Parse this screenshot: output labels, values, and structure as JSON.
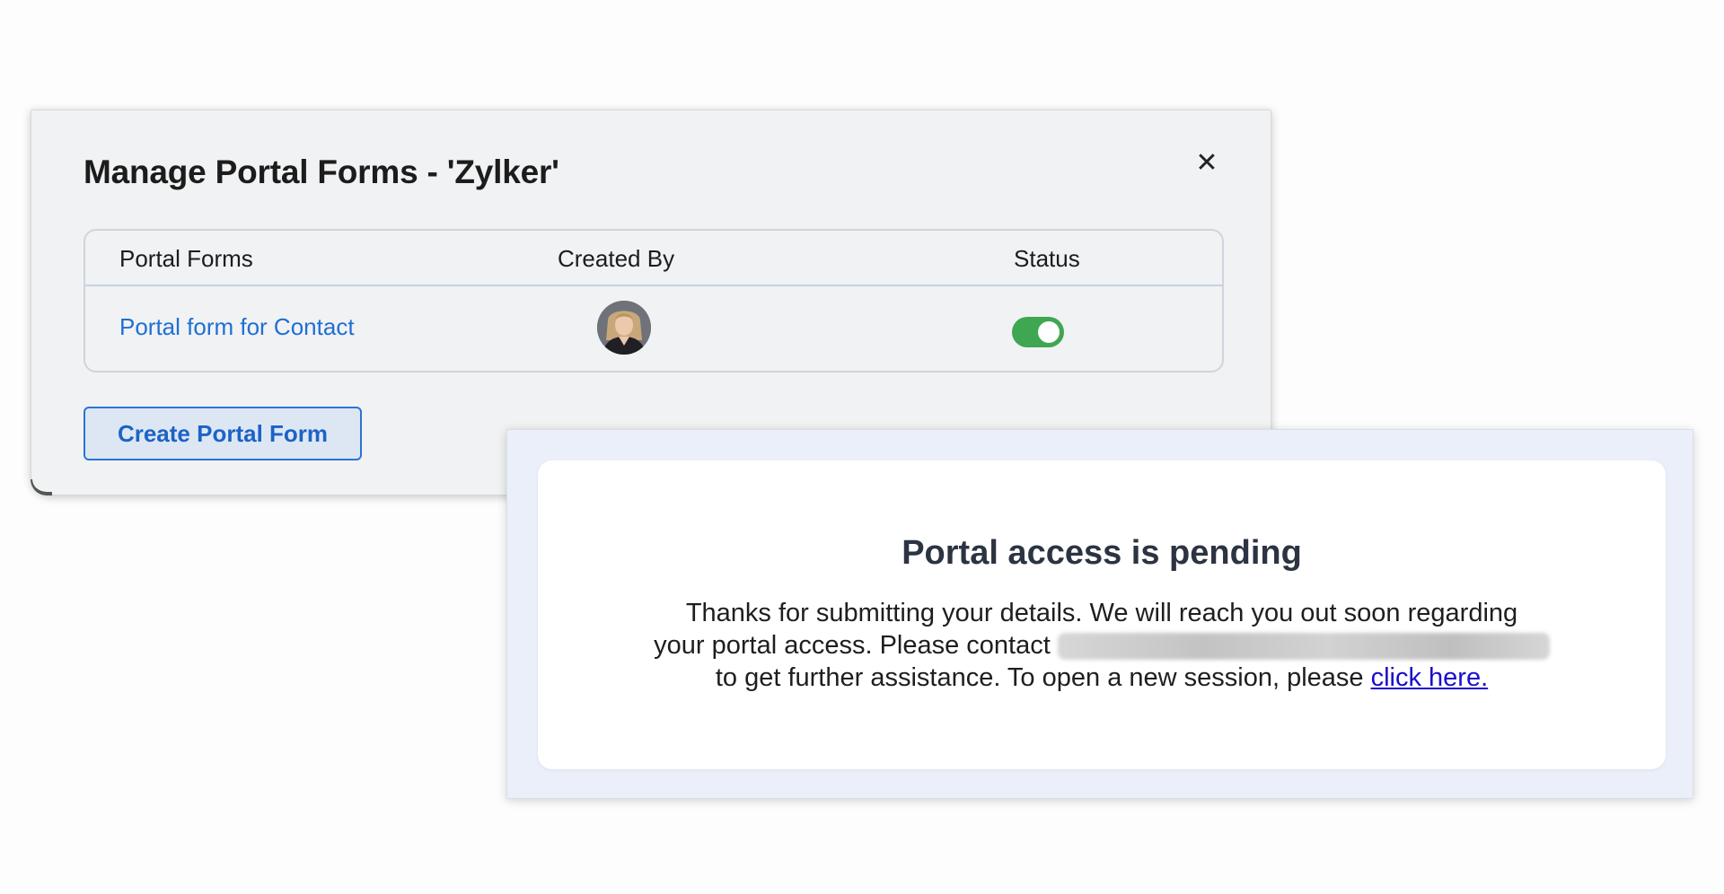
{
  "dialog": {
    "title": "Manage Portal Forms - 'Zylker'",
    "close_icon": "close-icon",
    "table": {
      "headers": [
        "Portal Forms",
        "Created By",
        "Status"
      ],
      "rows": [
        {
          "form_name": "Portal form for Contact",
          "created_by_avatar": "user-avatar",
          "status_enabled": true
        }
      ]
    },
    "create_button_label": "Create Portal Form"
  },
  "pending": {
    "title": "Portal access is pending",
    "line1": "Thanks for submitting your details. We will reach you out soon regarding",
    "line2": "your portal access. Please contact",
    "line3": "to get further assistance. To open a new session, please",
    "link_label": "click here."
  },
  "colors": {
    "link": "#1f6fd4",
    "toggle_on": "#3fa651",
    "hyperlink": "#1a0dca"
  }
}
